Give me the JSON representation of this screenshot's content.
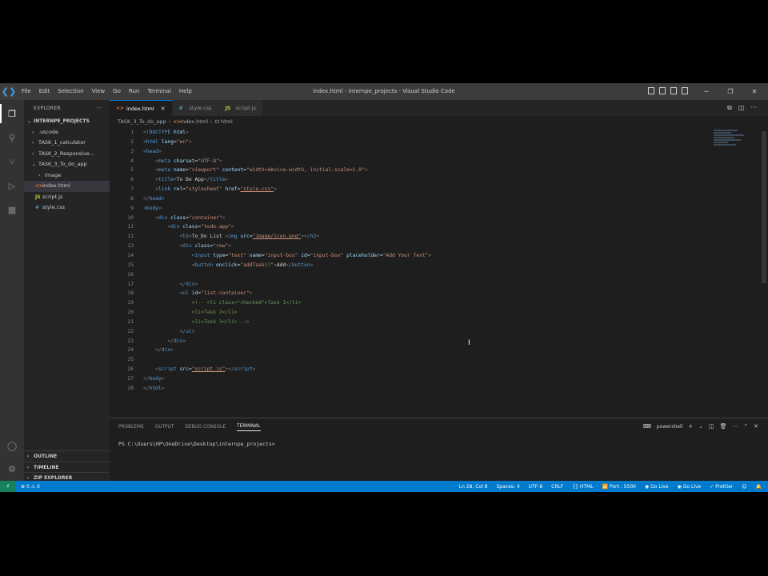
{
  "window": {
    "title": "index.html - internpe_projects - Visual Studio Code",
    "menu": [
      "File",
      "Edit",
      "Selection",
      "View",
      "Go",
      "Run",
      "Terminal",
      "Help"
    ]
  },
  "explorer": {
    "header": "EXPLORER",
    "root": "INTERNPE_PROJECTS",
    "items": [
      {
        "label": ".vscode"
      },
      {
        "label": "TASK_1_calculator"
      },
      {
        "label": "TASK_2_Responsive..."
      },
      {
        "label": "TASK_3_To_do_app"
      },
      {
        "label": "image"
      },
      {
        "label": "index.html"
      },
      {
        "label": "script.js"
      },
      {
        "label": "style.css"
      }
    ],
    "bottom_sections": [
      "OUTLINE",
      "TIMELINE",
      "ZIP EXPLORER"
    ]
  },
  "tabs": [
    {
      "label": "index.html"
    },
    {
      "label": "style.css"
    },
    {
      "label": "script.js"
    }
  ],
  "breadcrumb": [
    "TASK_3_To_do_app",
    "index.html",
    "html"
  ],
  "code_lines": {
    "n1": "1",
    "n2": "2",
    "n3": "3",
    "n4": "4",
    "n5": "5",
    "n6": "6",
    "n7": "7",
    "n8": "8",
    "n9": "9",
    "n10": "10",
    "n11": "11",
    "n12": "12",
    "n13": "13",
    "n14": "14",
    "n15": "15",
    "n16": "16",
    "n17": "17",
    "n18": "18",
    "n19": "19",
    "n20": "20",
    "n21": "21",
    "n22": "22",
    "n23": "23",
    "n24": "24",
    "n25": "25",
    "n26": "26",
    "n27": "27",
    "n28": "28"
  },
  "code": {
    "doctype": "DOCTYPE",
    "html": "html",
    "lang_attr": "lang",
    "lang_val": "\"en\"",
    "head": "head",
    "meta": "meta",
    "charset_attr": "charset",
    "charset_val": "\"UTF-8\"",
    "name_attr": "name",
    "viewport_val": "\"viewport\"",
    "content_attr": "content",
    "content_val": "\"width=device-width, initial-scale=1.0\"",
    "title": "title",
    "title_text": "To Do App",
    "link": "link",
    "rel_attr": "rel",
    "rel_val": "\"stylesheet\"",
    "href_attr": "href",
    "href_val": "\"style.css\"",
    "body": "body",
    "div": "div",
    "class_attr": "class",
    "container_val": "\"container\"",
    "todo_val": "\"todo-app\"",
    "h2": "h2",
    "h2_text": "To_Do List ",
    "img": "img",
    "src_attr": "src",
    "img_src_val": "\"image/icon.png\"",
    "row_val": "\"row\"",
    "input": "input",
    "type_attr": "type",
    "type_val": "\"text\"",
    "input_name_val": "\"input-box\"",
    "id_attr": "id",
    "input_id_val": "\"input-box\"",
    "placeholder_attr": "placeholder",
    "placeholder_val": "\"Add Your Text\"",
    "button": "button",
    "onclick_attr": "onclick",
    "onclick_val": "\"addTask()\"",
    "button_text": "Add",
    "ul": "ul",
    "list_id_val": "\"list-container\"",
    "comment1": "<!-- <li class=\"checked\">Task 1</li>",
    "comment2": "<li>Task 2</li>",
    "comment3": "<li>Task 3</li> -->",
    "script": "script",
    "script_src_val": "\"script.js\""
  },
  "panel": {
    "tabs": [
      "PROBLEMS",
      "OUTPUT",
      "DEBUG CONSOLE",
      "TERMINAL"
    ],
    "shell": "powershell",
    "prompt": "PS C:\\Users\\HP\\OneDrive\\Desktop\\internpe_projects>"
  },
  "statusbar": {
    "errors": "0",
    "warnings": "0",
    "position": "Ln 28, Col 8",
    "spaces": "Spaces: 4",
    "encoding": "UTF-8",
    "eol": "CRLF",
    "language": "HTML",
    "port": "Port : 5500",
    "golive1": "Go Live",
    "golive2": "Go Live",
    "prettier": "Prettier"
  }
}
